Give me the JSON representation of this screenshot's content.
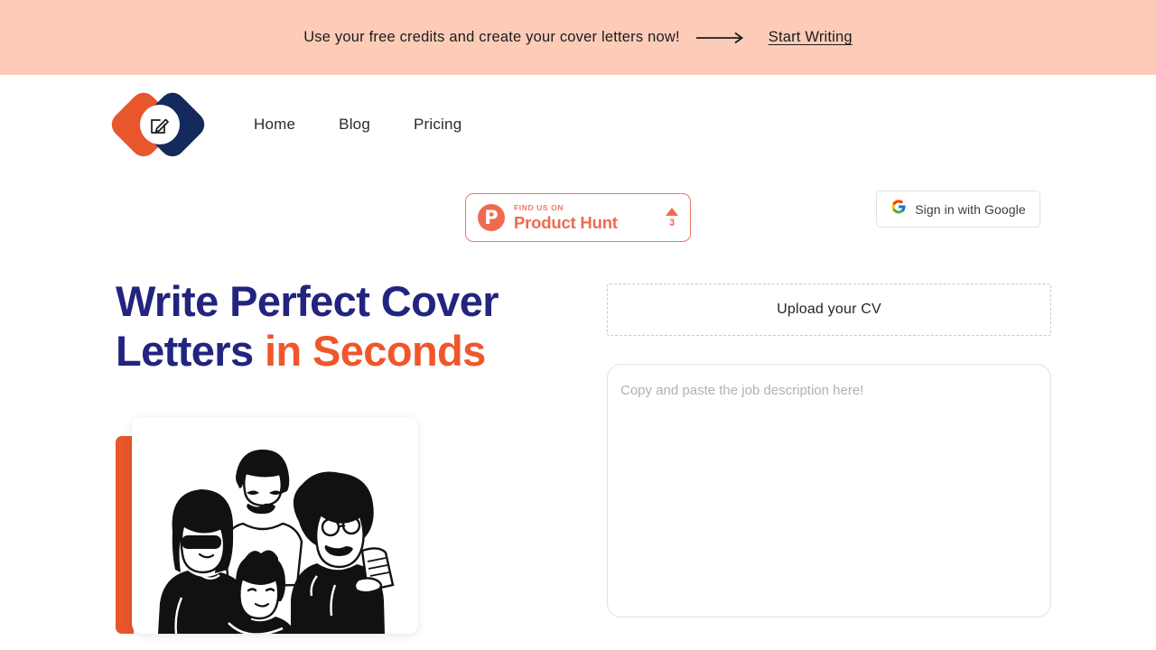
{
  "promo_banner": {
    "message": "Use your free credits and create your cover letters now!",
    "arrow_icon": "long-right-arrow-icon",
    "cta_label": "Start Writing",
    "background_color": "#fdccb8"
  },
  "header": {
    "logo": {
      "icon": "pencil-edit-logo-icon",
      "orange_color": "#e8562b",
      "navy_color": "#142a5c"
    },
    "nav": [
      {
        "label": "Home"
      },
      {
        "label": "Blog"
      },
      {
        "label": "Pricing"
      }
    ],
    "google_button": {
      "label": "Sign in with Google",
      "icon": "google-g-icon"
    }
  },
  "product_hunt_badge": {
    "logo_letter": "P",
    "kicker": "FIND US ON",
    "name": "Product Hunt",
    "upvote_icon": "upvote-triangle-icon",
    "vote_count": "3",
    "accent_color": "#ef6a51"
  },
  "hero": {
    "title_part1": "Write Perfect Cover Letters ",
    "title_accent": "in Seconds",
    "title_color": "#22247f",
    "accent_color": "#f1562b",
    "illustration": {
      "name": "group-of-people-illustration",
      "accent_bar_color": "#e8562b"
    }
  },
  "form": {
    "upload_label": "Upload your CV",
    "job_description_placeholder": "Copy and paste the job description here!",
    "job_description_value": ""
  }
}
